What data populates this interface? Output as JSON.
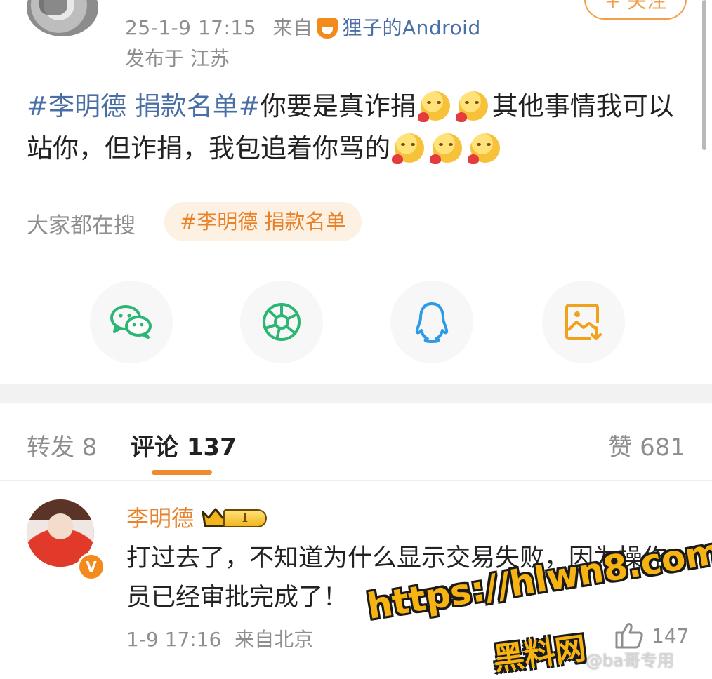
{
  "post": {
    "timestamp": "25-1-9 17:15",
    "source_prefix": "来自",
    "source_device": "狸子的Android",
    "location": "发布于 江苏",
    "follow_label": "+ 关注",
    "hashtag": "#李明德 捐款名单#",
    "text_part1": "你要是真诈捐",
    "text_part2": "其他事情我可以站你，但诈捐，我包追着你骂的"
  },
  "search": {
    "label": "大家都在搜",
    "chip": "#李明德 捐款名单"
  },
  "share": {
    "icons": [
      "wechat-icon",
      "moments-icon",
      "qq-icon",
      "save-image-icon"
    ]
  },
  "tabs": {
    "forward": "转发 8",
    "comment": "评论 137",
    "like": "赞 681"
  },
  "comment": {
    "author": "李明德",
    "level": "I",
    "verified_mark": "V",
    "text": "打过去了，不知道为什么显示交易失败，因为操作员已经审批完成了！",
    "time": "1-9 17:16",
    "source": "来自北京",
    "likes": "147"
  },
  "watermark": {
    "url": "https://hlwn8.com",
    "name": "黑料网",
    "user": "@ba哥专用"
  },
  "colors": {
    "accent": "#f08a2c",
    "link": "#4a6fa5",
    "muted": "#8e8e8e",
    "wechat": "#2bb673",
    "qq": "#2d9be6",
    "save": "#f1a11c"
  }
}
